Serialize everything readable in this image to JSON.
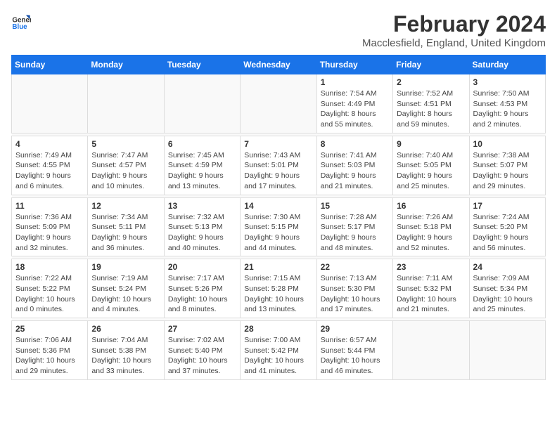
{
  "header": {
    "logo_line1": "General",
    "logo_line2": "Blue",
    "main_title": "February 2024",
    "subtitle": "Macclesfield, England, United Kingdom"
  },
  "weekdays": [
    "Sunday",
    "Monday",
    "Tuesday",
    "Wednesday",
    "Thursday",
    "Friday",
    "Saturday"
  ],
  "weeks": [
    [
      {
        "day": "",
        "info": ""
      },
      {
        "day": "",
        "info": ""
      },
      {
        "day": "",
        "info": ""
      },
      {
        "day": "",
        "info": ""
      },
      {
        "day": "1",
        "info": "Sunrise: 7:54 AM\nSunset: 4:49 PM\nDaylight: 8 hours\nand 55 minutes."
      },
      {
        "day": "2",
        "info": "Sunrise: 7:52 AM\nSunset: 4:51 PM\nDaylight: 8 hours\nand 59 minutes."
      },
      {
        "day": "3",
        "info": "Sunrise: 7:50 AM\nSunset: 4:53 PM\nDaylight: 9 hours\nand 2 minutes."
      }
    ],
    [
      {
        "day": "4",
        "info": "Sunrise: 7:49 AM\nSunset: 4:55 PM\nDaylight: 9 hours\nand 6 minutes."
      },
      {
        "day": "5",
        "info": "Sunrise: 7:47 AM\nSunset: 4:57 PM\nDaylight: 9 hours\nand 10 minutes."
      },
      {
        "day": "6",
        "info": "Sunrise: 7:45 AM\nSunset: 4:59 PM\nDaylight: 9 hours\nand 13 minutes."
      },
      {
        "day": "7",
        "info": "Sunrise: 7:43 AM\nSunset: 5:01 PM\nDaylight: 9 hours\nand 17 minutes."
      },
      {
        "day": "8",
        "info": "Sunrise: 7:41 AM\nSunset: 5:03 PM\nDaylight: 9 hours\nand 21 minutes."
      },
      {
        "day": "9",
        "info": "Sunrise: 7:40 AM\nSunset: 5:05 PM\nDaylight: 9 hours\nand 25 minutes."
      },
      {
        "day": "10",
        "info": "Sunrise: 7:38 AM\nSunset: 5:07 PM\nDaylight: 9 hours\nand 29 minutes."
      }
    ],
    [
      {
        "day": "11",
        "info": "Sunrise: 7:36 AM\nSunset: 5:09 PM\nDaylight: 9 hours\nand 32 minutes."
      },
      {
        "day": "12",
        "info": "Sunrise: 7:34 AM\nSunset: 5:11 PM\nDaylight: 9 hours\nand 36 minutes."
      },
      {
        "day": "13",
        "info": "Sunrise: 7:32 AM\nSunset: 5:13 PM\nDaylight: 9 hours\nand 40 minutes."
      },
      {
        "day": "14",
        "info": "Sunrise: 7:30 AM\nSunset: 5:15 PM\nDaylight: 9 hours\nand 44 minutes."
      },
      {
        "day": "15",
        "info": "Sunrise: 7:28 AM\nSunset: 5:17 PM\nDaylight: 9 hours\nand 48 minutes."
      },
      {
        "day": "16",
        "info": "Sunrise: 7:26 AM\nSunset: 5:18 PM\nDaylight: 9 hours\nand 52 minutes."
      },
      {
        "day": "17",
        "info": "Sunrise: 7:24 AM\nSunset: 5:20 PM\nDaylight: 9 hours\nand 56 minutes."
      }
    ],
    [
      {
        "day": "18",
        "info": "Sunrise: 7:22 AM\nSunset: 5:22 PM\nDaylight: 10 hours\nand 0 minutes."
      },
      {
        "day": "19",
        "info": "Sunrise: 7:19 AM\nSunset: 5:24 PM\nDaylight: 10 hours\nand 4 minutes."
      },
      {
        "day": "20",
        "info": "Sunrise: 7:17 AM\nSunset: 5:26 PM\nDaylight: 10 hours\nand 8 minutes."
      },
      {
        "day": "21",
        "info": "Sunrise: 7:15 AM\nSunset: 5:28 PM\nDaylight: 10 hours\nand 13 minutes."
      },
      {
        "day": "22",
        "info": "Sunrise: 7:13 AM\nSunset: 5:30 PM\nDaylight: 10 hours\nand 17 minutes."
      },
      {
        "day": "23",
        "info": "Sunrise: 7:11 AM\nSunset: 5:32 PM\nDaylight: 10 hours\nand 21 minutes."
      },
      {
        "day": "24",
        "info": "Sunrise: 7:09 AM\nSunset: 5:34 PM\nDaylight: 10 hours\nand 25 minutes."
      }
    ],
    [
      {
        "day": "25",
        "info": "Sunrise: 7:06 AM\nSunset: 5:36 PM\nDaylight: 10 hours\nand 29 minutes."
      },
      {
        "day": "26",
        "info": "Sunrise: 7:04 AM\nSunset: 5:38 PM\nDaylight: 10 hours\nand 33 minutes."
      },
      {
        "day": "27",
        "info": "Sunrise: 7:02 AM\nSunset: 5:40 PM\nDaylight: 10 hours\nand 37 minutes."
      },
      {
        "day": "28",
        "info": "Sunrise: 7:00 AM\nSunset: 5:42 PM\nDaylight: 10 hours\nand 41 minutes."
      },
      {
        "day": "29",
        "info": "Sunrise: 6:57 AM\nSunset: 5:44 PM\nDaylight: 10 hours\nand 46 minutes."
      },
      {
        "day": "",
        "info": ""
      },
      {
        "day": "",
        "info": ""
      }
    ]
  ]
}
